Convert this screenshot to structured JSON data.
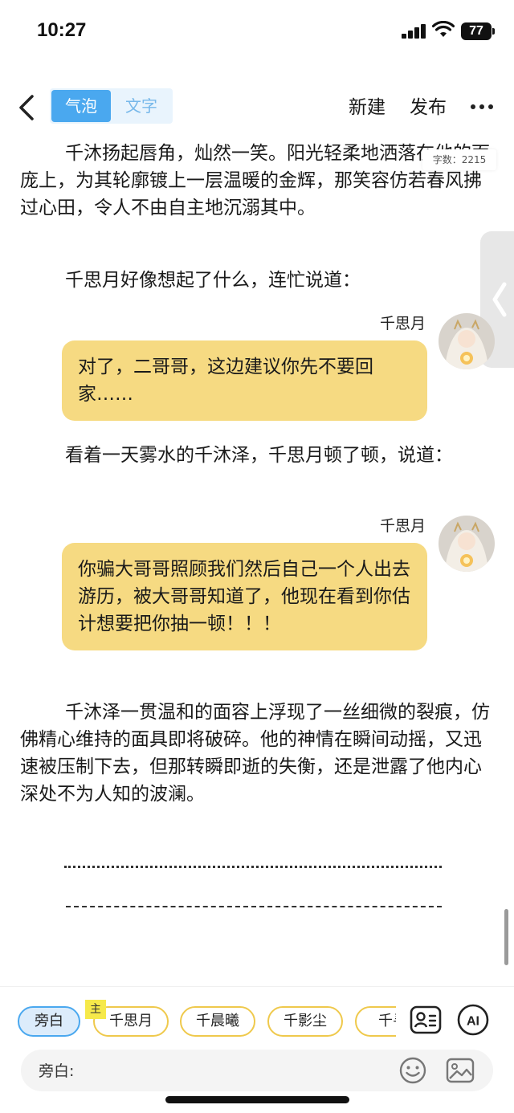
{
  "status_bar": {
    "time": "10:27",
    "battery": "77"
  },
  "nav": {
    "tabs": [
      {
        "label": "气泡",
        "active": true
      },
      {
        "label": "文字",
        "active": false
      }
    ],
    "new_label": "新建",
    "publish_label": "发布"
  },
  "content": {
    "word_count": "字数：2215",
    "paragraphs": [
      "千沐扬起唇角，灿然一笑。阳光轻柔地洒落在他的面庞上，为其轮廓镀上一层温暖的金辉，那笑容仿若春风拂过心田，令人不由自主地沉溺其中。",
      "千思月好像想起了什么，连忙说道：",
      "看着一天雾水的千沐泽，千思月顿了顿，说道：",
      "千沐泽一贯温和的面容上浮现了一丝细微的裂痕，仿佛精心维持的面具即将破碎。他的神情在瞬间动摇，又迅速被压制下去，但那转瞬即逝的失衡，还是泄露了他内心深处不为人知的波澜。"
    ],
    "bubbles": [
      {
        "speaker": "千思月",
        "text": "对了，二哥哥，这边建议你先不要回家……"
      },
      {
        "speaker": "千思月",
        "text": "你骗大哥哥照顾我们然后自己一个人出去游历，被大哥哥知道了，他现在看到你估计想要把你抽一顿！！！"
      }
    ]
  },
  "toolbar": {
    "main_badge": "主",
    "characters": [
      "旁白",
      "千思月",
      "千晨曦",
      "千影尘",
      "千寻"
    ],
    "input_label": "旁白:",
    "input_value": ""
  },
  "colors": {
    "accent": "#4aa8ef",
    "bubble": "#f6da82",
    "chip_border": "#efc94c",
    "badge": "#f6e94a"
  }
}
